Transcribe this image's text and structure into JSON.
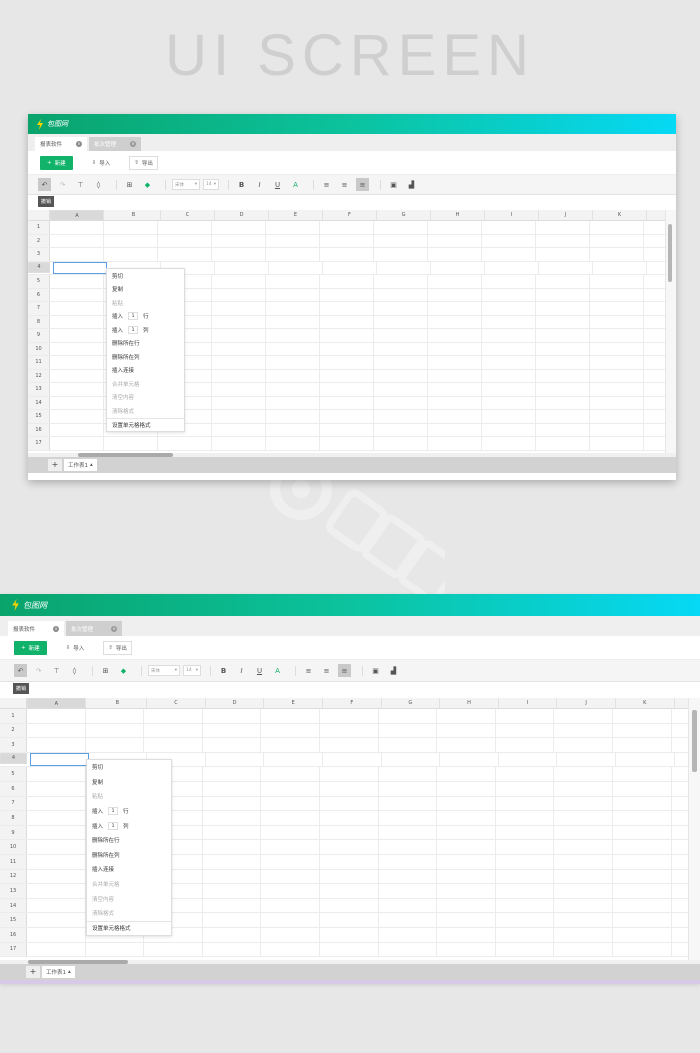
{
  "hero_title": "UI SCREEN",
  "app": {
    "brand": "包图网"
  },
  "tabs": [
    {
      "label": "报表软件",
      "active": true
    },
    {
      "label": "批次管理",
      "active": false
    }
  ],
  "toolbar1": {
    "new_label": "新建",
    "import_label": "导入",
    "export_label": "导出"
  },
  "toolbar2": {
    "font_family": "宋体",
    "font_size": "14",
    "bold": "B",
    "italic": "I",
    "underline": "U",
    "font_color": "A"
  },
  "tooltip": "撤销",
  "columns": [
    "A",
    "B",
    "C",
    "D",
    "E",
    "F",
    "G",
    "H",
    "I",
    "J",
    "K"
  ],
  "rows": [
    "1",
    "2",
    "3",
    "4",
    "5",
    "6",
    "7",
    "8",
    "9",
    "10",
    "11",
    "12",
    "13",
    "14",
    "15",
    "16",
    "17"
  ],
  "selected_row": "4",
  "selected_col": "A",
  "context_menu": {
    "cut": "剪切",
    "copy": "复制",
    "paste": "粘贴",
    "insert_row_prefix": "插入",
    "insert_row_count": "1",
    "insert_row_suffix": "行",
    "insert_col_prefix": "插入",
    "insert_col_count": "1",
    "insert_col_suffix": "列",
    "delete_row": "删除所在行",
    "delete_col": "删除所在列",
    "insert_link": "插入连接",
    "merge_cells": "合并单元格",
    "clear_content": "清空内容",
    "clear_format": "清除格式",
    "cell_format": "设置单元格格式"
  },
  "sheet": {
    "add": "+",
    "name": "工作表1"
  },
  "colors": {
    "accent_green": "#11b36a",
    "gradient_start": "#0aa36c",
    "gradient_end": "#06d9f5",
    "selection": "#5aa0e6"
  }
}
